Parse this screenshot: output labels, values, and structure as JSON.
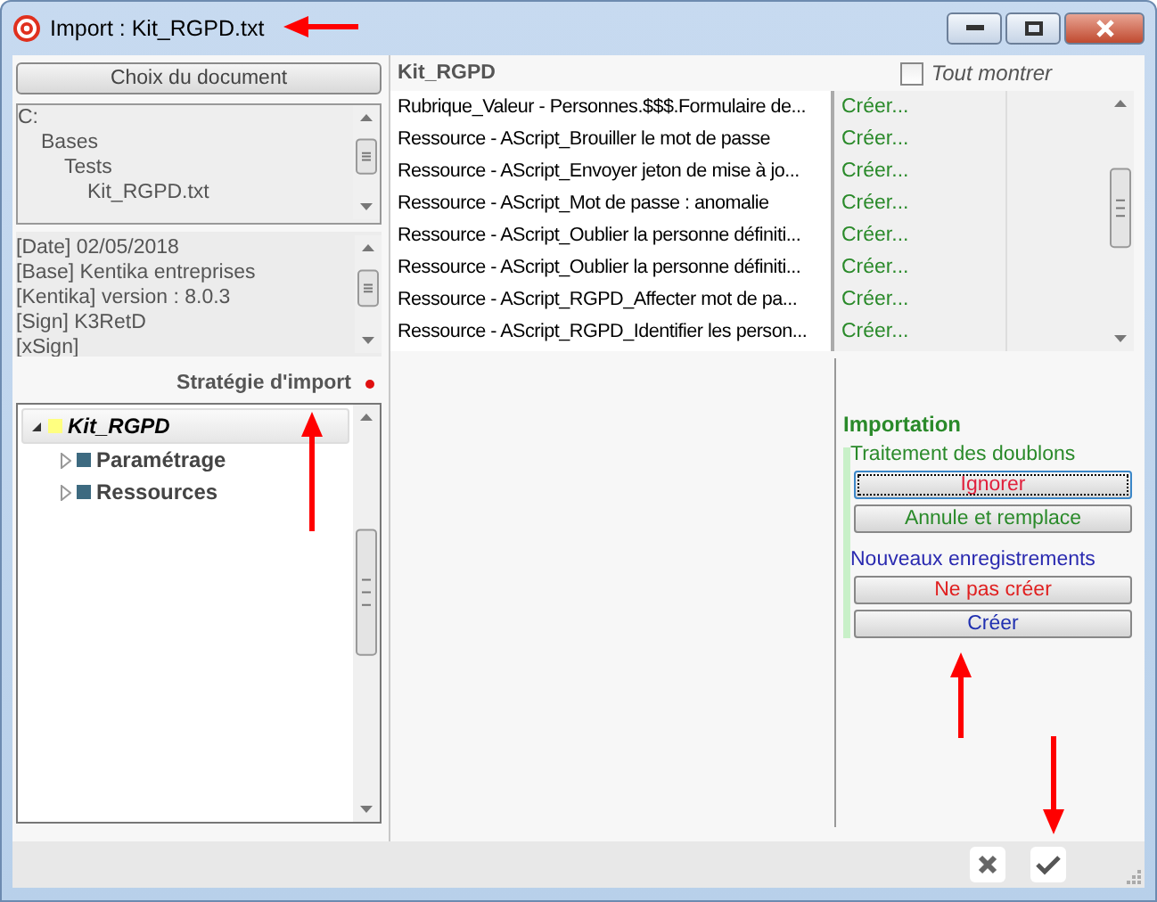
{
  "window": {
    "title": "Import : Kit_RGPD.txt"
  },
  "document": {
    "choose_button": "Choix du document",
    "folders": [
      {
        "label": "C:",
        "children": [
          {
            "label": "Bases",
            "children": [
              {
                "label": "Tests",
                "children": [
                  {
                    "label": "Kit_RGPD.txt"
                  }
                ]
              }
            ]
          }
        ]
      }
    ],
    "info": [
      "[Date] 02/05/2018",
      "[Base] Kentika entreprises",
      "[Kentika] version : 8.0.3",
      "[Sign] K3RetD",
      "[xSign]"
    ]
  },
  "strategy": {
    "label": "Stratégie d'import",
    "tree": [
      {
        "label": "Kit_RGPD",
        "color": "#ffff80",
        "expanded": true,
        "selected": true,
        "children": [
          {
            "label": "Paramétrage",
            "color": "#3d6a80",
            "expanded": false,
            "selected": false
          },
          {
            "label": "Ressources",
            "color": "#3d6a80",
            "expanded": false,
            "selected": false
          }
        ]
      }
    ]
  },
  "list": {
    "title": "Kit_RGPD",
    "show_all": {
      "label": "Tout montrer",
      "checked": false
    },
    "rows": [
      {
        "name": "Rubrique_Valeur - Personnes.$$$.Formulaire de...",
        "action": "Créer..."
      },
      {
        "name": "Ressource - AScript_Brouiller le mot de passe",
        "action": "Créer..."
      },
      {
        "name": "Ressource - AScript_Envoyer jeton de mise à jo...",
        "action": "Créer..."
      },
      {
        "name": "Ressource - AScript_Mot de passe : anomalie",
        "action": "Créer..."
      },
      {
        "name": "Ressource - AScript_Oublier la personne définiti...",
        "action": "Créer..."
      },
      {
        "name": "Ressource - AScript_Oublier la personne définiti...",
        "action": "Créer..."
      },
      {
        "name": "Ressource - AScript_RGPD_Affecter mot de pa...",
        "action": "Créer..."
      },
      {
        "name": "Ressource - AScript_RGPD_Identifier les person...",
        "action": "Créer..."
      }
    ]
  },
  "importation": {
    "title": "Importation",
    "duplicates": {
      "label": "Traitement des doublons",
      "options": [
        {
          "label": "Ignorer",
          "color": "#e0203c",
          "selected": true
        },
        {
          "label": "Annule et remplace",
          "color": "#2a8a2a",
          "selected": false
        }
      ]
    },
    "new_records": {
      "label": "Nouveaux enregistrements",
      "options": [
        {
          "label": "Ne pas créer",
          "color": "#e02020",
          "selected": false
        },
        {
          "label": "Créer",
          "color": "#2030b0",
          "selected": false
        }
      ]
    }
  }
}
